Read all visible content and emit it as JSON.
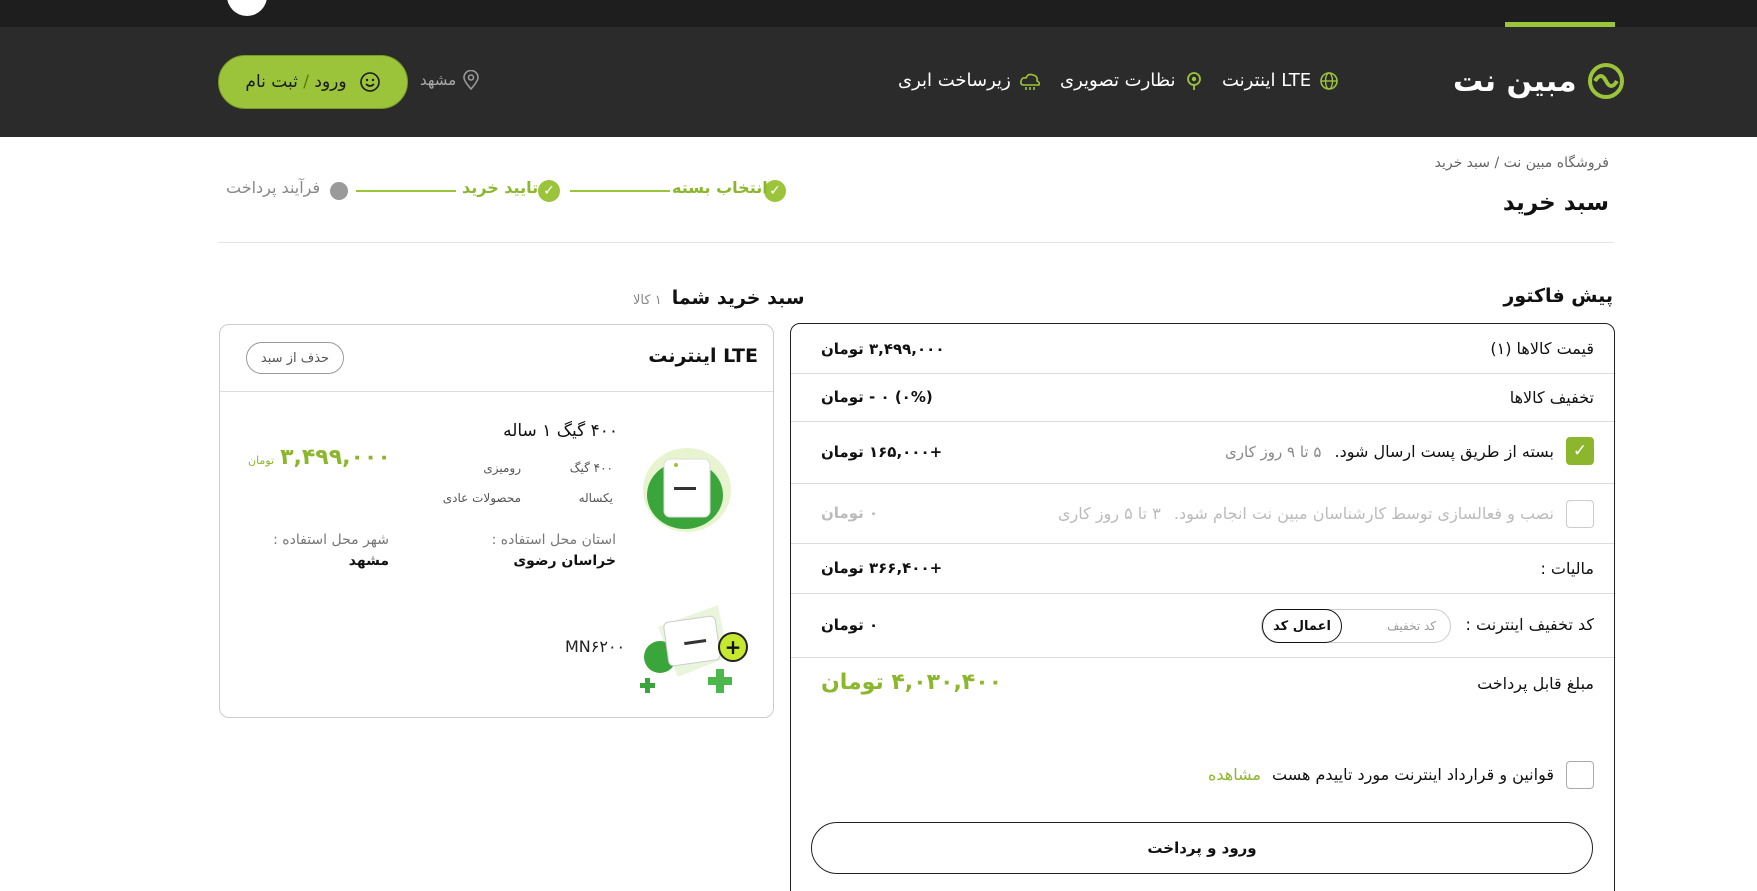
{
  "header": {
    "logo_text": "مبین نت",
    "nav": [
      {
        "label": "اینترنت LTE",
        "icon": "globe-icon"
      },
      {
        "label": "نظارت تصویری",
        "icon": "camera-icon"
      },
      {
        "label": "زیرساخت ابری",
        "icon": "cloud-icon"
      }
    ],
    "location": "مشهد",
    "login_label": "ورود",
    "login_sep": "/",
    "register_label": "ثبت نام"
  },
  "breadcrumb": {
    "home": "فروشگاه مبین نت",
    "sep": "/",
    "current": "سبد خرید"
  },
  "page_title": "سبد خرید",
  "steps": [
    {
      "label": "انتخاب بسته",
      "status": "done"
    },
    {
      "label": "تایید خرید",
      "status": "done"
    },
    {
      "label": "فرآیند پرداخت",
      "status": "pending"
    }
  ],
  "invoice": {
    "title": "پیش فاکتور",
    "items_price_label": "قیمت کالاها (۱)",
    "items_price_value": "۳,۴۹۹,۰۰۰ تومان",
    "discount_label": "تخفیف کالاها",
    "discount_value": "(۰%) ۰ - تومان",
    "post_label": "بسته از طریق پست ارسال شود.",
    "post_note": "۵ تا ۹ روز کاری",
    "post_value": "+۱۶۵,۰۰۰ تومان",
    "install_label": "نصب و فعالسازی توسط کارشناسان مبین نت انجام شود.",
    "install_note": "۳ تا ۵ روز کاری",
    "install_value": "۰ تومان",
    "tax_label": "مالیات :",
    "tax_value": "+۳۶۶,۴۰۰ تومان",
    "coupon_label": "کد تخفیف اینترنت :",
    "coupon_placeholder": "کد تخفیف",
    "coupon_apply": "اعمال کد",
    "coupon_value": "۰ تومان",
    "payable_label": "مبلغ قابل پرداخت",
    "payable_value": "۴,۰۳۰,۴۰۰ تومان",
    "terms_label": "قوانین و قرارداد اینترنت مورد تاییدم هست",
    "terms_link": "مشاهده",
    "pay_button": "ورود و پرداخت"
  },
  "cart": {
    "title": "سبد خرید شما",
    "count": "۱ کالا",
    "product_title": "اینترنت LTE",
    "remove_label": "حذف از سبد",
    "product_name": "۴۰۰ گیگ ۱ ساله",
    "spec_volume": "۴۰۰ گیگ",
    "spec_type": "رومیزی",
    "spec_period": "یکساله",
    "spec_category": "محصولات عادی",
    "price": "۳,۴۹۹,۰۰۰",
    "currency": "تومان",
    "province_label": "استان محل استفاده :",
    "province_value": "خراسان رضوی",
    "city_label": "شهر محل استفاده :",
    "city_value": "مشهد",
    "model": "MN۶۲۰۰"
  },
  "colors": {
    "accent": "#9cc43a",
    "header_bg": "#2b2b2b",
    "top_bg": "#1e1e1e"
  }
}
